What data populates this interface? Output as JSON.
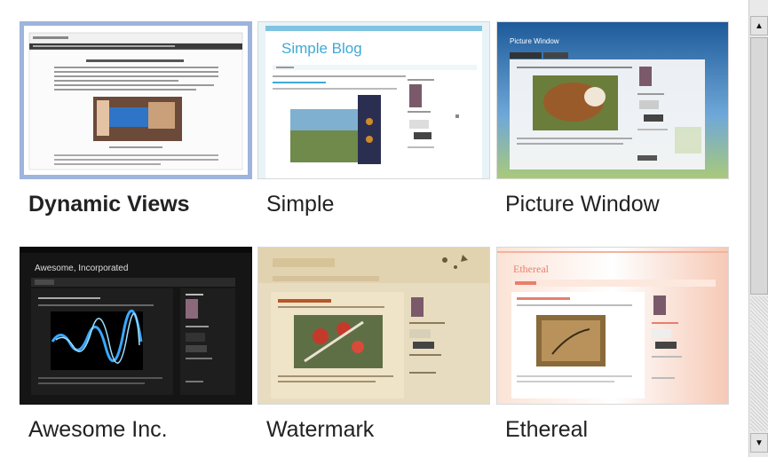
{
  "templates": [
    {
      "name": "Dynamic Views",
      "selected": true
    },
    {
      "name": "Simple",
      "selected": false,
      "blog_title": "Simple Blog"
    },
    {
      "name": "Picture Window",
      "selected": false,
      "blog_title": "Picture Window"
    },
    {
      "name": "Awesome Inc.",
      "selected": false,
      "blog_title": "Awesome, Incorporated"
    },
    {
      "name": "Watermark",
      "selected": false
    },
    {
      "name": "Ethereal",
      "selected": false,
      "blog_title": "Ethereal"
    }
  ],
  "colors": {
    "selected_border": "#9db4dc",
    "simple_accent": "#3fa9d6",
    "dark_bg": "#151515",
    "watermark_bg": "#e8dcc0",
    "ethereal_accent": "#e77f6e"
  },
  "scrollbar": {
    "up_glyph": "▲",
    "down_glyph": "▼"
  }
}
